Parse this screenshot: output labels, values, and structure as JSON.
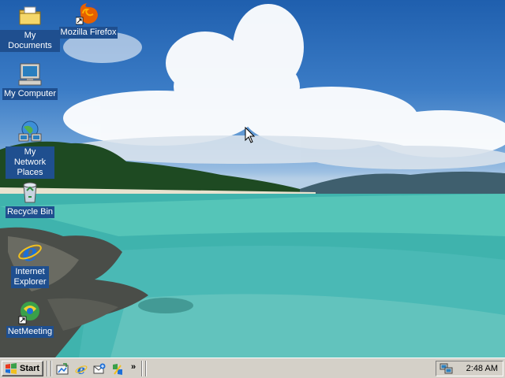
{
  "desktop": {
    "icons": [
      {
        "label": "My Documents",
        "icon": "folder-documents-icon"
      },
      {
        "label": "Mozilla Firefox",
        "icon": "firefox-icon",
        "shortcut": true
      },
      {
        "label": "My Computer",
        "icon": "computer-icon"
      },
      {
        "label": "My Network Places",
        "icon": "network-places-icon"
      },
      {
        "label": "Recycle Bin",
        "icon": "recycle-bin-icon"
      },
      {
        "label": "Internet Explorer",
        "icon": "internet-explorer-icon"
      },
      {
        "label": "NetMeeting",
        "icon": "netmeeting-icon",
        "shortcut": true
      }
    ]
  },
  "taskbar": {
    "start_label": "Start",
    "quick_launch": [
      "show-desktop-icon",
      "internet-explorer-icon",
      "outlook-express-icon",
      "windows-media-icon"
    ],
    "more_label": "»",
    "clock": "2:48 AM",
    "colors": {
      "taskbar": "#d4d0c8",
      "icon_label_bg": "#1f4f8f"
    }
  }
}
